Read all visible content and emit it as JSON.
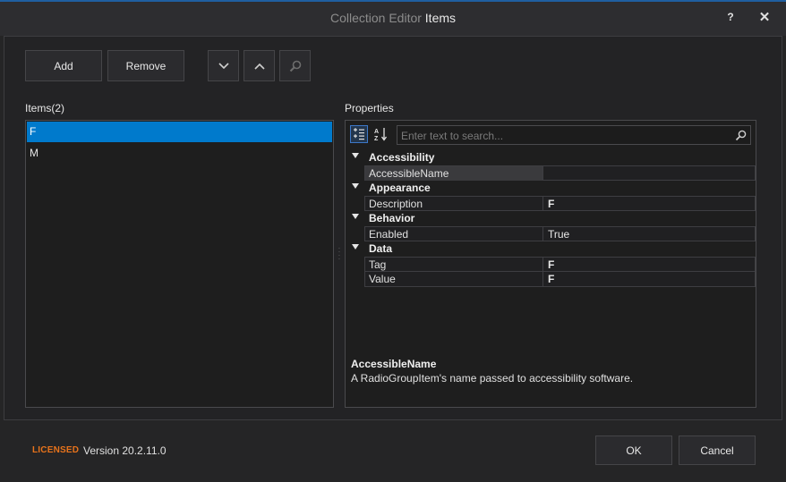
{
  "window": {
    "title_prefix": "Collection Editor",
    "title_main": "Items",
    "help_label": "?",
    "close_label": "✕"
  },
  "toolbar": {
    "add_label": "Add",
    "remove_label": "Remove",
    "move_down_icon": "chevron-down-icon",
    "move_up_icon": "chevron-up-icon",
    "search_icon": "magnifier-icon"
  },
  "items_panel": {
    "label": "Items(2)",
    "items": [
      "F",
      "M"
    ],
    "selected_index": 0
  },
  "properties_panel": {
    "label": "Properties",
    "search_placeholder": "Enter text to search...",
    "categories": [
      {
        "name": "Accessibility",
        "rows": [
          {
            "name": "AccessibleName",
            "value": "",
            "selected": true
          }
        ]
      },
      {
        "name": "Appearance",
        "rows": [
          {
            "name": "Description",
            "value": "F"
          }
        ]
      },
      {
        "name": "Behavior",
        "rows": [
          {
            "name": "Enabled",
            "value": "True"
          }
        ]
      },
      {
        "name": "Data",
        "rows": [
          {
            "name": "Tag",
            "value": "F"
          },
          {
            "name": "Value",
            "value": "F"
          }
        ]
      }
    ],
    "description_title": "AccessibleName",
    "description_text": "A RadioGroupItem's name passed to accessibility software."
  },
  "footer": {
    "licensed_label": "LICENSED",
    "version_label": "Version 20.2.11.0",
    "ok_label": "OK",
    "cancel_label": "Cancel"
  },
  "colors": {
    "accent": "#007acc",
    "licensed": "#e8731b",
    "background": "#252526"
  }
}
